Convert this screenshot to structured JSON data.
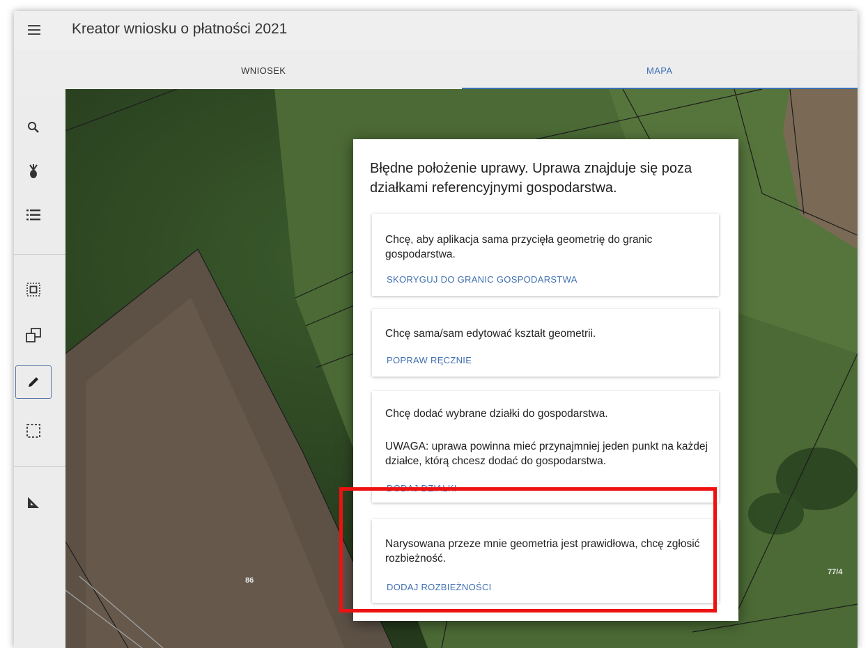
{
  "app": {
    "title": "Kreator wniosku o płatności 2021"
  },
  "tabs": [
    {
      "label": "WNIOSEK",
      "active": false
    },
    {
      "label": "MAPA",
      "active": true
    }
  ],
  "toolbar": {
    "tools": [
      "search-icon",
      "crop-icon",
      "list-icon",
      "select-inner-icon",
      "copy-shape-icon",
      "pencil-icon",
      "select-area-icon",
      "measure-icon"
    ],
    "active_tool": "pencil-icon"
  },
  "map": {
    "parcel_labels": [
      "86",
      "77/4"
    ]
  },
  "dialog": {
    "title": "Błędne położenie uprawy. Uprawa znajduje się poza działkami referencyjnymi gospodarstwa.",
    "cards": [
      {
        "text": "Chcę, aby aplikacja sama przycięła geometrię do granic gospodarstwa.",
        "action": "SKORYGUJ DO GRANIC GOSPODARSTWA"
      },
      {
        "text": "Chcę sama/sam edytować kształt geometrii.",
        "action": "POPRAW RĘCZNIE"
      },
      {
        "text": "Chcę dodać wybrane działki do gospodarstwa.",
        "note": "UWAGA: uprawa powinna mieć przynajmniej jeden punkt na każdej działce, którą chcesz dodać do gospodarstwa.",
        "action": "DODAJ DZIAŁKI"
      },
      {
        "text": "Narysowana przeze mnie geometria jest prawidłowa, chcę zgłosić rozbieżność.",
        "action": "DODAJ ROZBIEŻNOŚCI"
      }
    ]
  },
  "colors": {
    "accent": "#3b6fb6",
    "highlight": "#ee1111"
  }
}
